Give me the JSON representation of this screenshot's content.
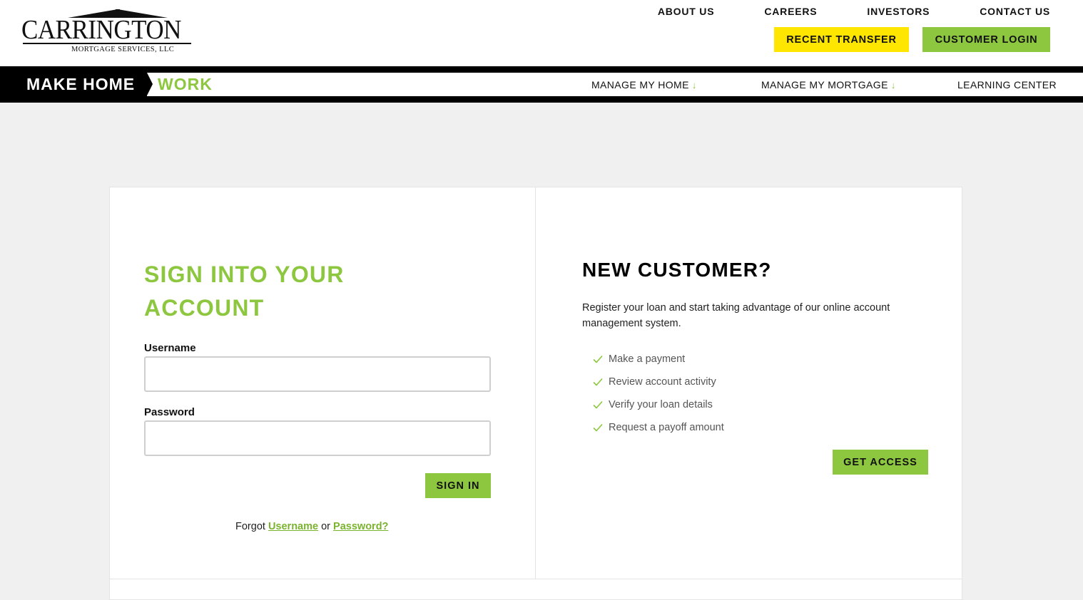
{
  "brand": {
    "name": "CARRINGTON",
    "subtitle": "MORTGAGE SERVICES, LLC",
    "tagline_main": "MAKE HOME",
    "tagline_accent": "WORK"
  },
  "top_nav": {
    "links": [
      "ABOUT US",
      "CAREERS",
      "INVESTORS",
      "CONTACT US"
    ],
    "recent_transfer": "RECENT TRANSFER",
    "customer_login": "CUSTOMER LOGIN"
  },
  "main_nav": {
    "manage_home": "MANAGE MY HOME",
    "manage_mortgage": "MANAGE MY MORTGAGE",
    "learning_center": "LEARNING CENTER",
    "dropdown_arrow": "↓"
  },
  "signin": {
    "title": "SIGN INTO YOUR ACCOUNT",
    "username_label": "Username",
    "username_value": "",
    "password_label": "Password",
    "password_value": "",
    "submit": "SIGN IN",
    "forgot_prefix": "Forgot",
    "forgot_username": "Username",
    "forgot_or": "or",
    "forgot_password": "Password?"
  },
  "new_customer": {
    "title": "NEW CUSTOMER?",
    "description": "Register your loan and start taking advantage of our online account management system.",
    "benefits": [
      "Make a payment",
      "Review account activity",
      "Verify your loan details",
      "Request a payoff amount"
    ],
    "cta": "GET ACCESS"
  },
  "colors": {
    "accent_green": "#8dc63f",
    "accent_yellow": "#ffe600",
    "nav_black": "#000000",
    "page_background": "#f0f0f0"
  },
  "icons": {
    "benefit_bullet": "check-icon",
    "logo_mark": "house-roof-icon"
  }
}
